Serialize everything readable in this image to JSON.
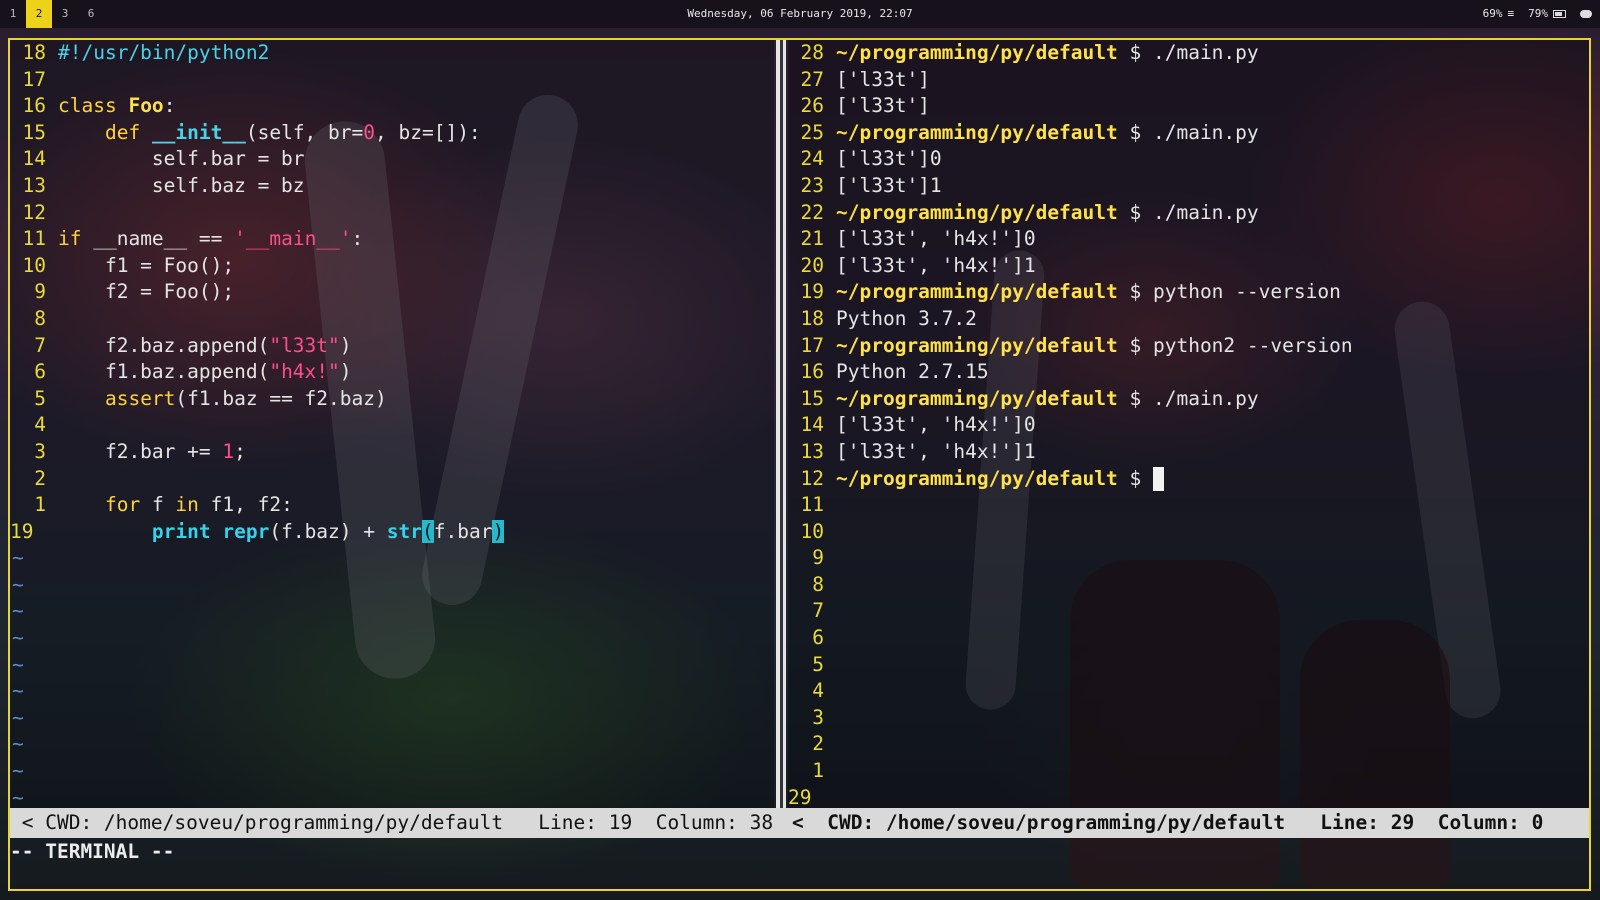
{
  "topbar": {
    "workspaces": [
      "1",
      "2",
      "3",
      "6"
    ],
    "active_workspace": "2",
    "clock": "Wednesday, 06 February 2019, 22:07",
    "volume": "69%",
    "volume_icon": "≡",
    "battery": "79%"
  },
  "left_pane": {
    "lines": [
      {
        "n": "18",
        "segs": [
          [
            "c-cyan",
            "#!/usr/bin/python2"
          ]
        ]
      },
      {
        "n": "17",
        "segs": []
      },
      {
        "n": "16",
        "segs": [
          [
            "c-kw",
            "class "
          ],
          [
            "c-yel",
            "Foo"
          ],
          [
            "",
            ":"
          ]
        ]
      },
      {
        "n": "15",
        "segs": [
          [
            "",
            "    "
          ],
          [
            "c-kw",
            "def "
          ],
          [
            "c-fn",
            "__init__"
          ],
          [
            "",
            "(self, br="
          ],
          [
            "c-num",
            "0"
          ],
          [
            "",
            ", bz=[]):"
          ]
        ]
      },
      {
        "n": "14",
        "segs": [
          [
            "",
            "        self.bar = br"
          ]
        ]
      },
      {
        "n": "13",
        "segs": [
          [
            "",
            "        self.baz = bz"
          ]
        ]
      },
      {
        "n": "12",
        "segs": []
      },
      {
        "n": "11",
        "segs": [
          [
            "c-kw",
            "if "
          ],
          [
            "",
            "__name__ == "
          ],
          [
            "c-str",
            "'__main__'"
          ],
          [
            "",
            ":"
          ]
        ]
      },
      {
        "n": "10",
        "segs": [
          [
            "",
            "    f1 = Foo();"
          ]
        ]
      },
      {
        "n": "9",
        "segs": [
          [
            "",
            "    f2 = Foo();"
          ]
        ]
      },
      {
        "n": "8",
        "segs": []
      },
      {
        "n": "7",
        "segs": [
          [
            "",
            "    f2.baz.append("
          ],
          [
            "c-str",
            "\"l33t\""
          ],
          [
            "",
            ")"
          ]
        ]
      },
      {
        "n": "6",
        "segs": [
          [
            "",
            "    f1.baz.append("
          ],
          [
            "c-str",
            "\"h4x!\""
          ],
          [
            "",
            ")"
          ]
        ]
      },
      {
        "n": "5",
        "segs": [
          [
            "",
            "    "
          ],
          [
            "c-kw",
            "assert"
          ],
          [
            "",
            "(f1.baz == f2.baz)"
          ]
        ]
      },
      {
        "n": "4",
        "segs": []
      },
      {
        "n": "3",
        "segs": [
          [
            "",
            "    f2.bar += "
          ],
          [
            "c-num",
            "1"
          ],
          [
            "",
            ";"
          ]
        ]
      },
      {
        "n": "2",
        "segs": []
      },
      {
        "n": "1",
        "segs": [
          [
            "",
            "    "
          ],
          [
            "c-kw",
            "for "
          ],
          [
            "",
            "f "
          ],
          [
            "c-kw",
            "in "
          ],
          [
            "",
            "f1, f2:"
          ]
        ]
      },
      {
        "n": "19",
        "cur": true,
        "segs": [
          [
            "",
            "        "
          ],
          [
            "bold-c",
            "print "
          ],
          [
            "bold-c",
            "repr"
          ],
          [
            "",
            "(f.baz) + "
          ],
          [
            "bold-c",
            "str"
          ],
          [
            "hl",
            "("
          ],
          [
            "",
            "f.bar"
          ],
          [
            "hl",
            ")"
          ]
        ]
      }
    ],
    "tildes": [
      "~",
      "~",
      "~",
      "~",
      "~",
      "~",
      "~",
      "~",
      "~",
      "~"
    ]
  },
  "right_pane": {
    "lines": [
      {
        "n": "28",
        "segs": [
          [
            "prompt",
            "~/programming/py/default"
          ],
          [
            "dollar",
            " $ ./main.py"
          ]
        ]
      },
      {
        "n": "27",
        "segs": [
          [
            "",
            "['l33t']"
          ]
        ]
      },
      {
        "n": "26",
        "segs": [
          [
            "",
            "['l33t']"
          ]
        ]
      },
      {
        "n": "25",
        "segs": [
          [
            "prompt",
            "~/programming/py/default"
          ],
          [
            "dollar",
            " $ ./main.py"
          ]
        ]
      },
      {
        "n": "24",
        "segs": [
          [
            "",
            "['l33t']0"
          ]
        ]
      },
      {
        "n": "23",
        "segs": [
          [
            "",
            "['l33t']1"
          ]
        ]
      },
      {
        "n": "22",
        "segs": [
          [
            "prompt",
            "~/programming/py/default"
          ],
          [
            "dollar",
            " $ ./main.py"
          ]
        ]
      },
      {
        "n": "21",
        "segs": [
          [
            "",
            "['l33t', 'h4x!']0"
          ]
        ]
      },
      {
        "n": "20",
        "segs": [
          [
            "",
            "['l33t', 'h4x!']1"
          ]
        ]
      },
      {
        "n": "19",
        "segs": [
          [
            "prompt",
            "~/programming/py/default"
          ],
          [
            "dollar",
            " $ python --version"
          ]
        ]
      },
      {
        "n": "18",
        "segs": [
          [
            "",
            "Python 3.7.2"
          ]
        ]
      },
      {
        "n": "17",
        "segs": [
          [
            "prompt",
            "~/programming/py/default"
          ],
          [
            "dollar",
            " $ python2 --version"
          ]
        ]
      },
      {
        "n": "16",
        "segs": [
          [
            "",
            "Python 2.7.15"
          ]
        ]
      },
      {
        "n": "15",
        "segs": [
          [
            "prompt",
            "~/programming/py/default"
          ],
          [
            "dollar",
            " $ ./main.py"
          ]
        ]
      },
      {
        "n": "14",
        "segs": [
          [
            "",
            "['l33t', 'h4x!']0"
          ]
        ]
      },
      {
        "n": "13",
        "segs": [
          [
            "",
            "['l33t', 'h4x!']1"
          ]
        ]
      },
      {
        "n": "12",
        "segs": [
          [
            "prompt",
            "~/programming/py/default"
          ],
          [
            "dollar",
            " $ "
          ]
        ],
        "cursor": true
      },
      {
        "n": "11",
        "segs": []
      },
      {
        "n": "10",
        "segs": []
      },
      {
        "n": "9",
        "segs": []
      },
      {
        "n": "8",
        "segs": []
      },
      {
        "n": "7",
        "segs": []
      },
      {
        "n": "6",
        "segs": []
      },
      {
        "n": "5",
        "segs": []
      },
      {
        "n": "4",
        "segs": []
      },
      {
        "n": "3",
        "segs": []
      },
      {
        "n": "2",
        "segs": []
      },
      {
        "n": "1",
        "segs": []
      },
      {
        "n": "29",
        "cur": true,
        "segs": []
      }
    ]
  },
  "status": {
    "left": " < CWD: /home/soveu/programming/py/default   Line: 19  Column: 38",
    "right": "<  CWD: /home/soveu/programming/py/default   Line: 29  Column: 0"
  },
  "mode": "-- TERMINAL --",
  "colors": {
    "border": "#e8d42a",
    "line_number": "#e9da3a",
    "keyword": "#ffd23a",
    "string": "#ff4d8d",
    "builtin": "#4ad2e8"
  }
}
